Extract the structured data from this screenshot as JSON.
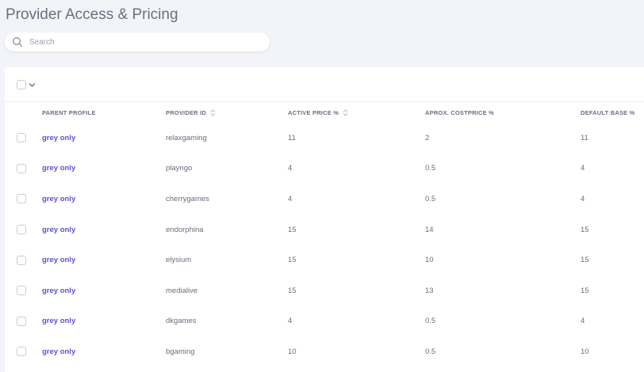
{
  "page": {
    "title": "Provider Access & Pricing"
  },
  "search": {
    "placeholder": "Search"
  },
  "table": {
    "columns": {
      "parent_profile": "PARENT PROFILE",
      "provider_id": "PROVIDER ID",
      "active_price": "ACTIVE PRICE %",
      "costprice": "APROX. COSTPRICE %",
      "default_base": "DEFAULT BASE %"
    },
    "rows": [
      {
        "profile": "grey only",
        "provider": "relaxgaming",
        "active": "11",
        "cost": "2",
        "base": "11"
      },
      {
        "profile": "grey only",
        "provider": "playngo",
        "active": "4",
        "cost": "0.5",
        "base": "4"
      },
      {
        "profile": "grey only",
        "provider": "cherrygames",
        "active": "4",
        "cost": "0.5",
        "base": "4"
      },
      {
        "profile": "grey only",
        "provider": "endorphina",
        "active": "15",
        "cost": "14",
        "base": "15"
      },
      {
        "profile": "grey only",
        "provider": "elysium",
        "active": "15",
        "cost": "10",
        "base": "15"
      },
      {
        "profile": "grey only",
        "provider": "medialive",
        "active": "15",
        "cost": "13",
        "base": "15"
      },
      {
        "profile": "grey only",
        "provider": "dkgames",
        "active": "4",
        "cost": "0.5",
        "base": "4"
      },
      {
        "profile": "grey only",
        "provider": "bgaming",
        "active": "10",
        "cost": "0.5",
        "base": "10"
      }
    ]
  },
  "colors": {
    "accent": "#5a55c9",
    "background": "#f3f4f9"
  }
}
